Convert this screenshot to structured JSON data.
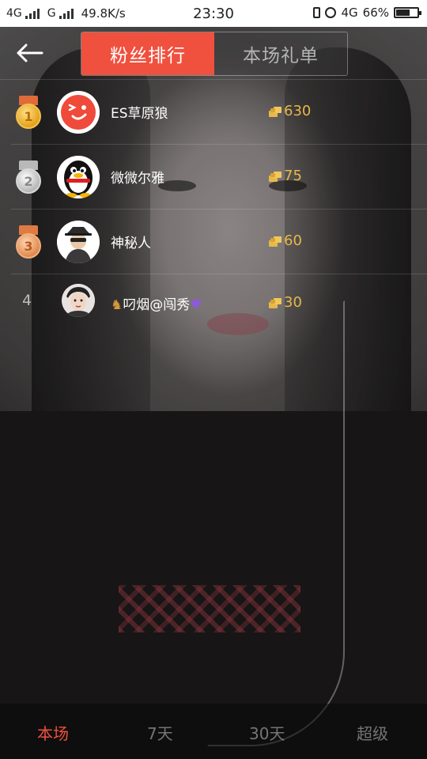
{
  "status_bar": {
    "network_left": "4G",
    "network_mid": "G",
    "speed": "49.8K/s",
    "time": "23:30",
    "network_right": "4G",
    "battery_percent_label": "66%",
    "battery_level": 0.66
  },
  "header": {
    "back_icon": "arrow-left-icon",
    "tabs": [
      {
        "label": "粉丝排行",
        "active": true
      },
      {
        "label": "本场礼单",
        "active": false
      }
    ]
  },
  "ranking": [
    {
      "rank": "1",
      "name": "ES草原狼",
      "count": "630",
      "medal": "gold"
    },
    {
      "rank": "2",
      "name": "微微尔雅",
      "count": "75",
      "medal": "silver"
    },
    {
      "rank": "3",
      "name": "神秘人",
      "count": "60",
      "medal": "bronze"
    },
    {
      "rank": "4",
      "name": "叼烟@闯秀",
      "count": "30",
      "medal": ""
    }
  ],
  "bottom_tabs": [
    {
      "label": "本场",
      "active": true
    },
    {
      "label": "7天",
      "active": false
    },
    {
      "label": "30天",
      "active": false
    },
    {
      "label": "超级",
      "active": false
    }
  ],
  "colors": {
    "accent": "#f0503e",
    "gift_count": "#e7b84a"
  }
}
